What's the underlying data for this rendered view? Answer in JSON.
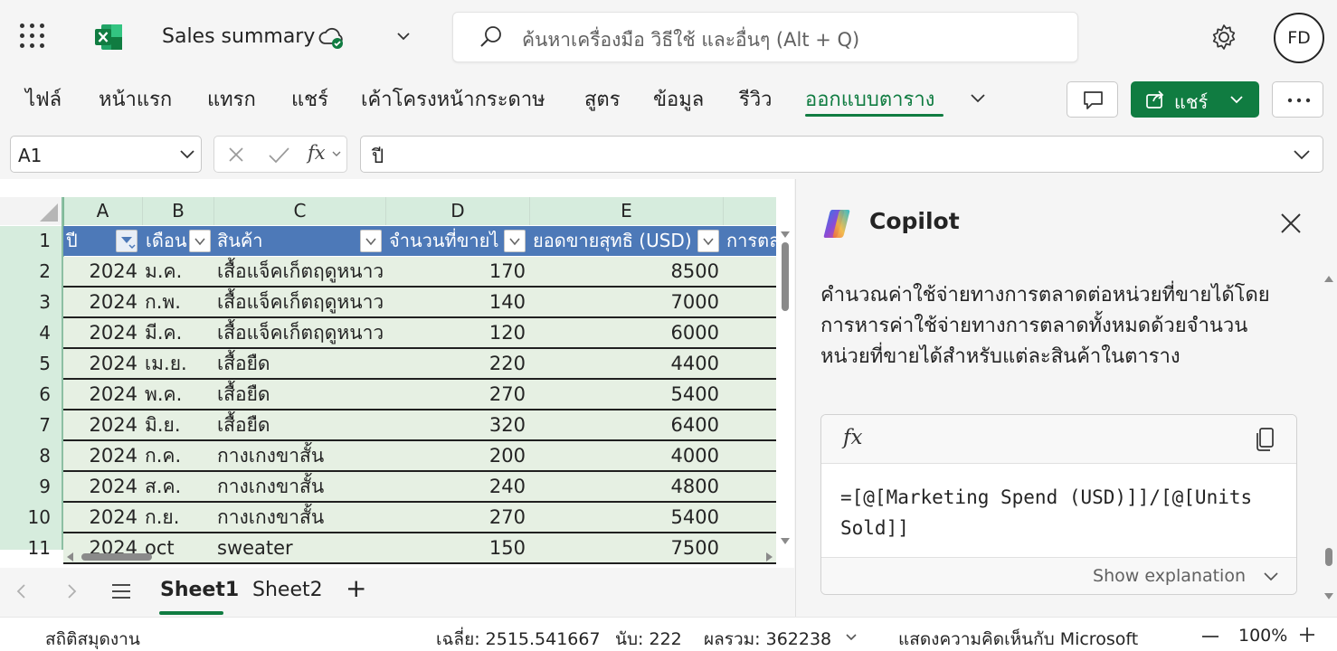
{
  "title_bar": {
    "app_name": "Sales summary",
    "search_placeholder": "ค้นหาเครื่องมือ วิธีใช้ และอื่นๆ (Alt + Q)",
    "avatar_initials": "FD"
  },
  "ribbon": {
    "tabs": [
      "ไฟล์",
      "หน้าแรก",
      "แทรก",
      "แชร์",
      "เค้าโครงหน้ากระดาษ",
      "สูตร",
      "ข้อมูล",
      "รีวิว",
      "ออกแบบตาราง"
    ],
    "active_tab": "ออกแบบตาราง",
    "share_label": "แชร์"
  },
  "formula_bar": {
    "name_box": "A1",
    "fx_label": "fx",
    "formula_value": "ปี"
  },
  "grid": {
    "column_letters": [
      "A",
      "B",
      "C",
      "D",
      "E"
    ],
    "row_numbers": [
      "1",
      "2",
      "3",
      "4",
      "5",
      "6",
      "7",
      "8",
      "9",
      "10",
      "11"
    ],
    "table_headers": [
      "ปี",
      "เดือน",
      "สินค้า",
      "จำนวนที่ขายไ",
      "ยอดขายสุทธิ (USD)",
      "การตล"
    ],
    "rows": [
      [
        "2024",
        "ม.ค.",
        "เสื้อแจ็คเก็ตฤดูหนาว",
        "170",
        "8500"
      ],
      [
        "2024",
        "ก.พ.",
        "เสื้อแจ็คเก็ตฤดูหนาว",
        "140",
        "7000"
      ],
      [
        "2024",
        "มี.ค.",
        "เสื้อแจ็คเก็ตฤดูหนาว",
        "120",
        "6000"
      ],
      [
        "2024",
        "เม.ย.",
        "เสื้อยืด",
        "220",
        "4400"
      ],
      [
        "2024",
        "พ.ค.",
        "เสื้อยืด",
        "270",
        "5400"
      ],
      [
        "2024",
        "มิ.ย.",
        "เสื้อยืด",
        "320",
        "6400"
      ],
      [
        "2024",
        "ก.ค.",
        "กางเกงขาสั้น",
        "200",
        "4000"
      ],
      [
        "2024",
        "ส.ค.",
        "กางเกงขาสั้น",
        "240",
        "4800"
      ],
      [
        "2024",
        "ก.ย.",
        "กางเกงขาสั้น",
        "270",
        "5400"
      ],
      [
        "2024",
        "oct",
        "sweater",
        "150",
        "7500"
      ]
    ]
  },
  "sheets": {
    "tabs": [
      "Sheet1",
      "Sheet2"
    ],
    "active": "Sheet1",
    "add_label": "+"
  },
  "copilot": {
    "title": "Copilot",
    "message": "คำนวณค่าใช้จ่ายทางการตลาดต่อหน่วยที่ขายได้โดยการหารค่าใช้จ่ายทางการตลาดทั้งหมดด้วยจำนวนหน่วยที่ขายได้สำหรับแต่ละสินค้าในตาราง",
    "code_label": "fx",
    "code": "=[@[Marketing Spend (USD)]]/[@[Units Sold]]",
    "explain_label": "Show explanation"
  },
  "status_bar": {
    "workbook_stats": "สถิติสมุดงาน",
    "average": "เฉลี่ย: 2515.541667",
    "count": "นับ: 222",
    "sum": "ผลรวม: 362238",
    "feedback": "แสดงความคิดเห็นกับ Microsoft",
    "zoom": "100%"
  },
  "colors": {
    "excel_green": "#107c41",
    "table_header_blue": "#4d79b8",
    "row_band": "#e6f0e3",
    "header_highlight": "#d6ecdd"
  }
}
